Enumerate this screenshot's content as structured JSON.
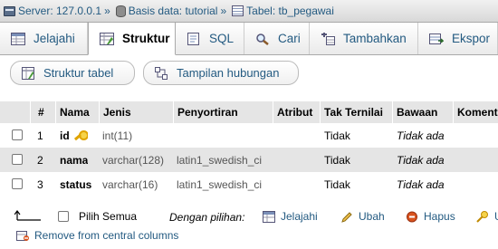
{
  "breadcrumb": {
    "server": "Server: 127.0.0.1",
    "database": "Basis data: tutorial",
    "table": "Tabel: tb_pegawai",
    "separator": "»"
  },
  "tabs": [
    {
      "label": "Jelajahi",
      "icon": "browse-icon",
      "active": false
    },
    {
      "label": "Struktur",
      "icon": "structure-icon",
      "active": true
    },
    {
      "label": "SQL",
      "icon": "sql-icon",
      "active": false
    },
    {
      "label": "Cari",
      "icon": "search-icon",
      "active": false
    },
    {
      "label": "Tambahkan",
      "icon": "insert-icon",
      "active": false
    },
    {
      "label": "Ekspor",
      "icon": "export-icon",
      "active": false
    }
  ],
  "subtabs": [
    {
      "label": "Struktur tabel",
      "icon": "table-structure-icon"
    },
    {
      "label": "Tampilan hubungan",
      "icon": "relation-view-icon"
    }
  ],
  "table": {
    "headers": [
      "#",
      "Nama",
      "Jenis",
      "Penyortiran",
      "Atribut",
      "Tak Ternilai",
      "Bawaan",
      "Komentar"
    ],
    "rows": [
      {
        "num": "1",
        "name": "id",
        "type": "int(11)",
        "collation": "",
        "attributes": "",
        "null": "Tidak",
        "default": "Tidak ada",
        "primary_key": true
      },
      {
        "num": "2",
        "name": "nama",
        "type": "varchar(128)",
        "collation": "latin1_swedish_ci",
        "attributes": "",
        "null": "Tidak",
        "default": "Tidak ada",
        "primary_key": false
      },
      {
        "num": "3",
        "name": "status",
        "type": "varchar(16)",
        "collation": "latin1_swedish_ci",
        "attributes": "",
        "null": "Tidak",
        "default": "Tidak ada",
        "primary_key": false
      }
    ]
  },
  "footer": {
    "check_all": "Pilih Semua",
    "with_selected": "Dengan pilihan:",
    "actions": [
      {
        "label": "Jelajahi",
        "icon": "browse-icon"
      },
      {
        "label": "Ubah",
        "icon": "pencil-icon"
      },
      {
        "label": "Hapus",
        "icon": "delete-icon"
      },
      {
        "label": "U",
        "icon": "primary-key-icon"
      }
    ],
    "remove_central": "Remove from central columns"
  },
  "colors": {
    "link": "#235a81",
    "row_alt": "#e5e5e5",
    "delete": "#d9531e"
  }
}
